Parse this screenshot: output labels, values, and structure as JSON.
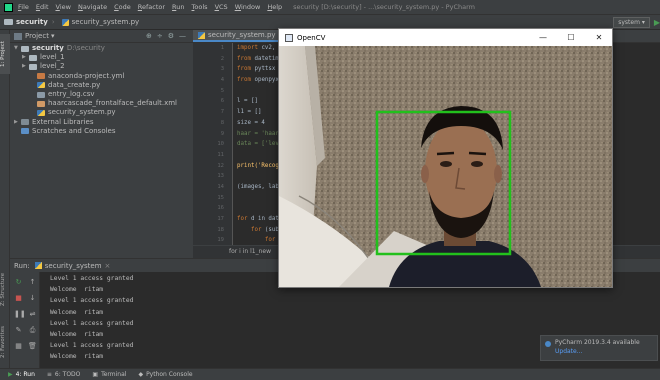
{
  "ide": {
    "menu": [
      "File",
      "Edit",
      "View",
      "Navigate",
      "Code",
      "Refactor",
      "Run",
      "Tools",
      "VCS",
      "Window",
      "Help"
    ],
    "window_title": "security [D:\\security] - ...\\security_system.py - PyCharm",
    "nav": {
      "project": "security",
      "file": "security_system.py",
      "run_config": "system"
    },
    "strip": {
      "project": "1: Project",
      "structure": "Z: Structure",
      "favorites": "2: Favorites"
    },
    "project_panel": {
      "title": "Project",
      "tree": [
        {
          "label": "security",
          "sub": "D:\\security",
          "type": "folder",
          "indent": 0,
          "arrow": "▼"
        },
        {
          "label": "level_1",
          "type": "folder",
          "indent": 1,
          "arrow": "▶"
        },
        {
          "label": "level_2",
          "type": "folder",
          "indent": 1,
          "arrow": "▶"
        },
        {
          "label": "anaconda-project.yml",
          "type": "yml",
          "indent": 2,
          "arrow": ""
        },
        {
          "label": "data_create.py",
          "type": "py",
          "indent": 2,
          "arrow": ""
        },
        {
          "label": "entry_log.csv",
          "type": "csv",
          "indent": 2,
          "arrow": ""
        },
        {
          "label": "haarcascade_frontalface_default.xml",
          "type": "xml",
          "indent": 2,
          "arrow": ""
        },
        {
          "label": "security_system.py",
          "type": "py",
          "indent": 2,
          "arrow": ""
        },
        {
          "label": "External Libraries",
          "type": "lib",
          "indent": 0,
          "arrow": "▶"
        },
        {
          "label": "Scratches and Consoles",
          "type": "scr",
          "indent": 0,
          "arrow": ""
        }
      ]
    },
    "editor": {
      "tab": "security_system.py",
      "line_numbers": [
        "1",
        "2",
        "3",
        "4",
        "5",
        "6",
        "7",
        "8",
        "9",
        "10",
        "11",
        "12",
        "13",
        "14",
        "15",
        "16",
        "17",
        "18",
        "19"
      ],
      "lines": [
        {
          "k": "import",
          "r": " cv2, nu"
        },
        {
          "k": "from",
          "r": " datetime"
        },
        {
          "k": "from",
          "r": " pyttsx impo"
        },
        {
          "k": "from",
          "r": " openpyxl"
        },
        {
          "k": "",
          "r": ""
        },
        {
          "k": "",
          "r": "l = []"
        },
        {
          "k": "",
          "r": "l1 = []"
        },
        {
          "k": "",
          "r": "size = 4"
        },
        {
          "k": "",
          "r": "haar = 'haarca"
        },
        {
          "k": "",
          "r": "data = ['level"
        },
        {
          "k": "",
          "r": ""
        },
        {
          "k": "",
          "r": "print('Recogni"
        },
        {
          "k": "",
          "r": ""
        },
        {
          "k": "",
          "r": "(images, lable"
        },
        {
          "k": "",
          "r": ""
        },
        {
          "k": "",
          "r": ""
        },
        {
          "k": "for",
          "r": " d in data:"
        },
        {
          "k": "    for",
          "r": " (subdi"
        },
        {
          "k": "        for",
          "r": " su"
        }
      ],
      "breadcrumb": "for i in l1_new"
    },
    "run": {
      "label": "Run:",
      "tab": "security_system",
      "output": [
        "Level 1 access granted",
        "Welcome  ritam",
        "Level 1 access granted",
        "Welcome  ritam",
        "Level 1 access granted",
        "Welcome  ritam",
        "Level 1 access granted",
        "Welcome  ritam"
      ]
    },
    "notification": {
      "title": "PyCharm 2019.3.4 available",
      "link": "Update..."
    },
    "bottom_tabs": [
      {
        "icon": "▶",
        "label": "4: Run",
        "active": true
      },
      {
        "icon": "≡",
        "label": "6: TODO"
      },
      {
        "icon": "▣",
        "label": "Terminal"
      },
      {
        "icon": "◆",
        "label": "Python Console"
      }
    ]
  },
  "opencv": {
    "title": "OpenCV",
    "controls": [
      "—",
      "☐",
      "✕"
    ],
    "face_box_color": "#22c01c"
  }
}
